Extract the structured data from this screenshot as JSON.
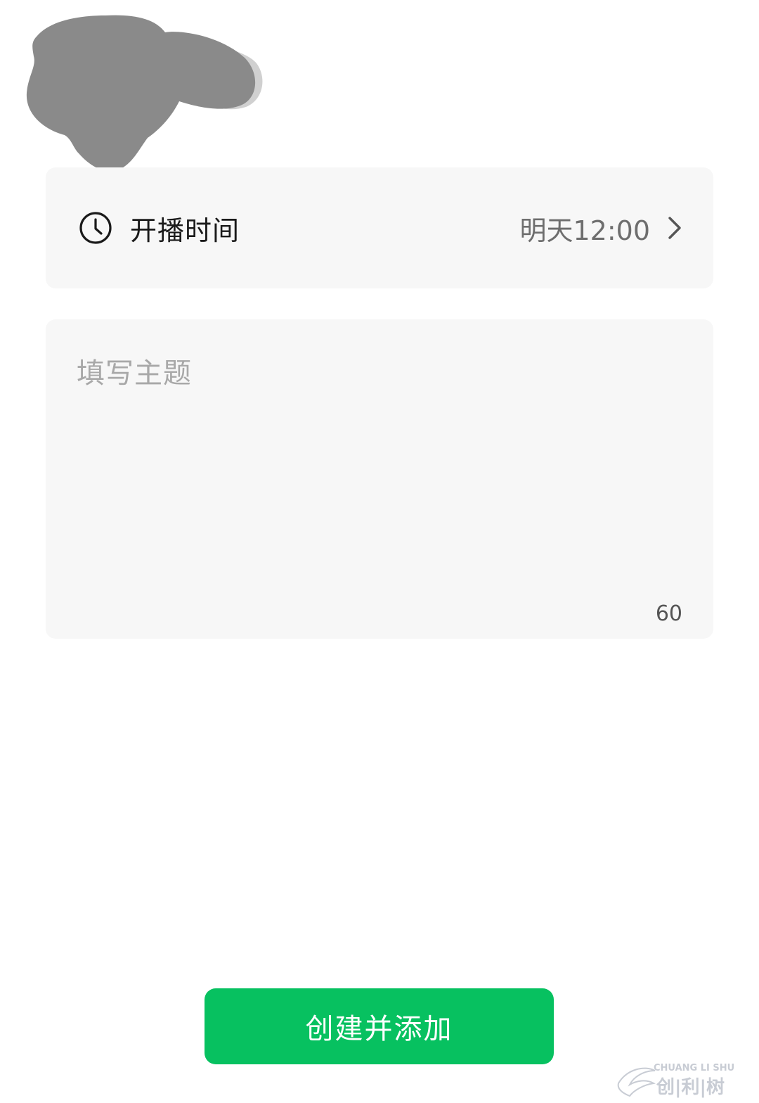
{
  "schedule": {
    "label": "开播时间",
    "value": "明天12:00",
    "icon": "clock-icon",
    "chevron_icon": "chevron-right-icon"
  },
  "topic": {
    "value": "",
    "placeholder": "填写主题",
    "char_counter": "60"
  },
  "actions": {
    "create_label": "创建并添加"
  },
  "watermark": {
    "text_en": "CHUANG LI SHU",
    "text_cn": "创 | 利 | 树"
  },
  "colors": {
    "accent": "#07c160",
    "card_bg": "#f7f7f7",
    "redaction": "#8a8a8a"
  }
}
